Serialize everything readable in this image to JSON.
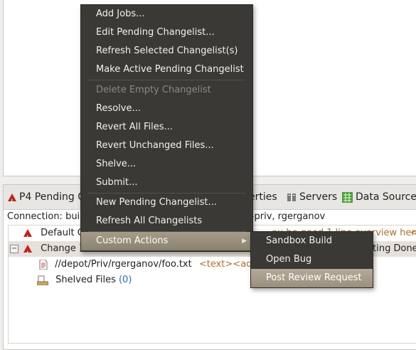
{
  "tabs": {
    "pending_label": "P4 Pending C",
    "properties_label": "erties",
    "servers_label": "Servers",
    "datasource_label": "Data Source"
  },
  "connection": {
    "prefix": "Connection: build",
    "suffix": "ganov-priv, rgerganov"
  },
  "tree": {
    "default_label": "Default C",
    "default_tail": "ou be good 1 line overview here!>",
    "default_tail_lt": "<",
    "change_label": "Change 1",
    "change_tail": "cting Done:",
    "file_path": "//depot/Priv/rgerganov/foo.txt",
    "file_tags": "<text><add>",
    "shelved_label": "Shelved Files",
    "shelved_count": "(0)"
  },
  "menu": {
    "items": [
      "Add Jobs...",
      "Edit Pending Changelist...",
      "Refresh Selected Changelist(s)",
      "Make Active Pending Changelist",
      "Delete Empty Changelist",
      "Resolve...",
      "Revert All Files...",
      "Revert Unchanged Files...",
      "Shelve...",
      "Submit...",
      "New Pending Changelist...",
      "Refresh All Changelists",
      "Custom Actions"
    ]
  },
  "submenu": {
    "items": [
      "Sandbox Build",
      "Open Bug",
      "Post Review Request"
    ]
  },
  "colors": {
    "menu_bg": "#3b3935",
    "menu_highlight": "#a59b88",
    "error_red": "#c0241b",
    "link_blue": "#2a6fc4"
  }
}
